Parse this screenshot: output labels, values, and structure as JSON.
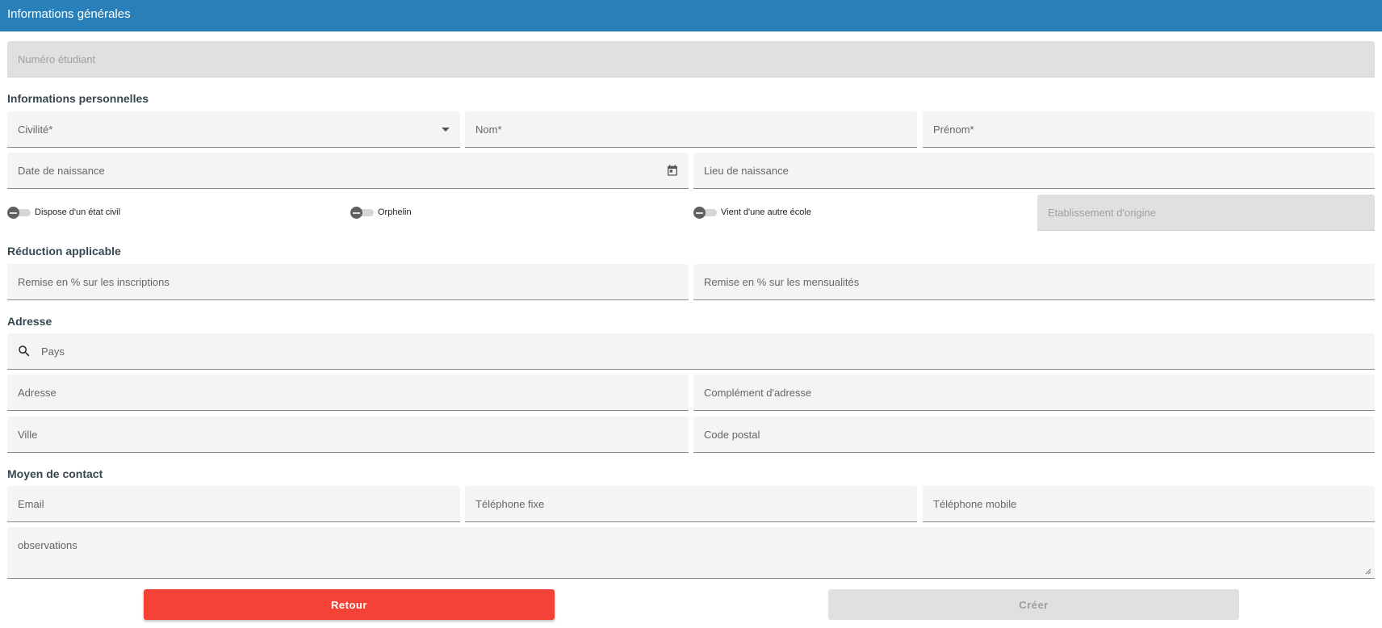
{
  "header": {
    "title": "Informations générales"
  },
  "fields": {
    "student_number": "Numéro étudiant",
    "civility": "Civilité*",
    "last_name": "Nom*",
    "first_name": "Prénom*",
    "birth_date": "Date de naissance",
    "birth_place": "Lieu de naissance",
    "origin_school": "Etablissement d'origine",
    "discount_registration": "Remise en % sur les inscriptions",
    "discount_monthly": "Remise en % sur les mensualités",
    "country": "Pays",
    "address": "Adresse",
    "address_extra": "Complément d'adresse",
    "city": "Ville",
    "postal_code": "Code postal",
    "email": "Email",
    "phone_landline": "Téléphone fixe",
    "phone_mobile": "Téléphone mobile",
    "observations": "observations"
  },
  "sections": {
    "personal": "Informations personnelles",
    "discount": "Réduction applicable",
    "address": "Adresse",
    "contact": "Moyen de contact"
  },
  "toggles": [
    {
      "label": "Dispose d'un état civil",
      "checked": false
    },
    {
      "label": "Orphelin",
      "checked": false
    },
    {
      "label": "Vient d'une autre école",
      "checked": false
    }
  ],
  "buttons": {
    "back": "Retour",
    "create": "Créer"
  },
  "colors": {
    "header": "#2980b9",
    "back_button": "#f44336",
    "disabled": "#e0e0e0"
  }
}
